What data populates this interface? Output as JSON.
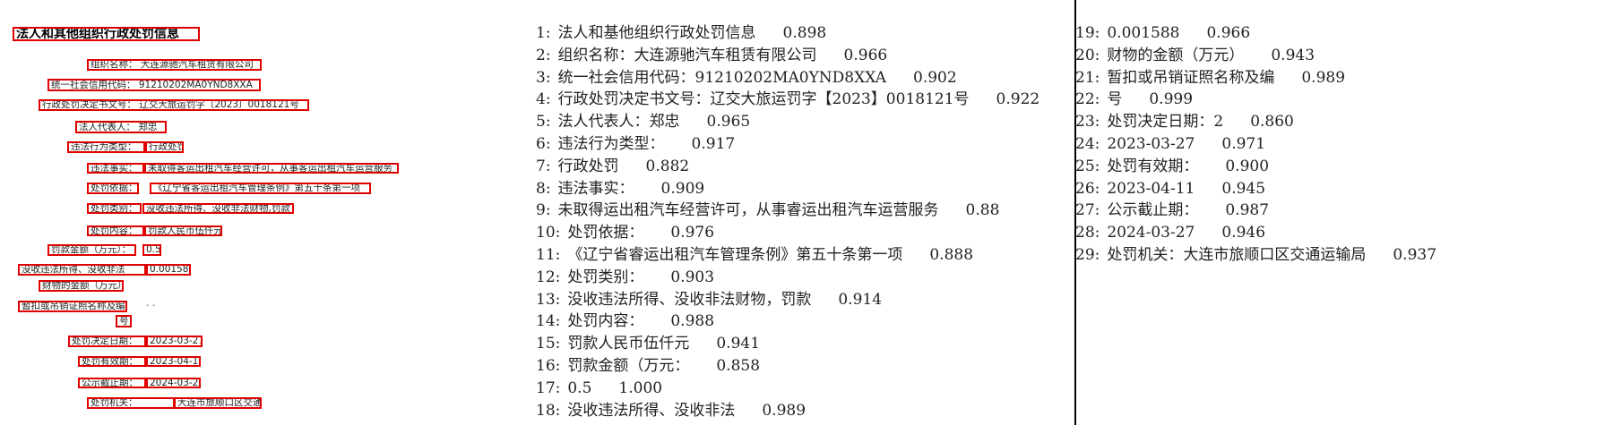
{
  "document": {
    "title": "法人和其他组织行政处罚信息",
    "fields": {
      "org_name": "组织名称： 大连源驰汽车租赁有限公司",
      "credit_code": "统一社会信用代码： 91210202MA0YND8XXA",
      "decision_no": "行政处罚决定书文号： 辽交大旅运罚字〔2023〕0018121号",
      "legal_rep": "法人代表人： 郑忠",
      "violation_type_label": "违法行为类型：",
      "violation_type_value": "行政处罚",
      "facts_label": "违法事实：",
      "facts_value": "未取得客运出租汽车经营许可，从事客运出租汽车运营服务",
      "basis_label": "处罚依据：",
      "basis_value": "《辽宁省客运出租汽车管理条例》第五十条第一项",
      "category_label": "处罚类别：",
      "category_value": "没收违法所得、没收非法财物,罚款",
      "content_label": "处罚内容：",
      "content_value": "罚款人民币伍仟元",
      "fine_label": "罚款金额（万元）：",
      "fine_value": "0.5",
      "confiscate_label": "没收违法所得、没收非法",
      "confiscate_value": "0.001588",
      "confiscate_label2": "财物的金额（万元）",
      "license_label": "暂扣或吊销证照名称及编",
      "license_value": "- -",
      "license_label2": "号",
      "decision_date_label": "处罚决定日期：",
      "decision_date_value": "2023-03-27",
      "valid_label": "处罚有效期：",
      "valid_value": "2023-04-11",
      "publicity_label": "公示截止期：",
      "publicity_value": "2024-03-27",
      "authority_label": "处罚机关：",
      "authority_value": "大连市旅顺口区交通运输局"
    }
  },
  "results": [
    {
      "idx": "1:",
      "text": "法人和基他组织行政处罚信息",
      "score": "0.898"
    },
    {
      "idx": "2:",
      "text": "组织名称：大连源驰汽车租赁有限公司",
      "score": "0.966"
    },
    {
      "idx": "3:",
      "text": "统一社会信用代码：91210202MA0YND8XXA",
      "score": "0.902"
    },
    {
      "idx": "4:",
      "text": "行政处罚决定书文号：辽交大旅运罚字【2023】0018121号",
      "score": "0.922"
    },
    {
      "idx": "5:",
      "text": "法人代表人：郑忠",
      "score": "0.965"
    },
    {
      "idx": "6:",
      "text": "违法行为类型：",
      "score": "0.917"
    },
    {
      "idx": "7:",
      "text": "行政处罚",
      "score": "0.882"
    },
    {
      "idx": "8:",
      "text": "违法事实：",
      "score": "0.909"
    },
    {
      "idx": "9:",
      "text": "未取得运出租汽车经营许可，从事睿运出租汽车运营服务",
      "score": "0.88"
    },
    {
      "idx": "10:",
      "text": "处罚依据：",
      "score": "0.976"
    },
    {
      "idx": "11:",
      "text": "《辽宁省睿运出租汽车管理条例》第五十条第一项",
      "score": "0.888"
    },
    {
      "idx": "12:",
      "text": "处罚类别：",
      "score": "0.903"
    },
    {
      "idx": "13:",
      "text": "没收违法所得、没收非法财物，罚款",
      "score": "0.914"
    },
    {
      "idx": "14:",
      "text": "处罚内容：",
      "score": "0.988"
    },
    {
      "idx": "15:",
      "text": "罚款人民币伍仟元",
      "score": "0.941"
    },
    {
      "idx": "16:",
      "text": "罚款金额（万元：",
      "score": "0.858"
    },
    {
      "idx": "17:",
      "text": "0.5",
      "score": "1.000"
    },
    {
      "idx": "18:",
      "text": "没收违法所得、没收非法",
      "score": "0.989"
    },
    {
      "idx": "19:",
      "text": "0.001588",
      "score": "0.966"
    },
    {
      "idx": "20:",
      "text": "财物的金额（万元）",
      "score": "0.943"
    },
    {
      "idx": "21:",
      "text": "暂扣或吊销证照名称及编",
      "score": "0.989"
    },
    {
      "idx": "22:",
      "text": "号",
      "score": "0.999"
    },
    {
      "idx": "23:",
      "text": "处罚决定日期：2",
      "score": "0.860"
    },
    {
      "idx": "24:",
      "text": "2023-03-27",
      "score": "0.971"
    },
    {
      "idx": "25:",
      "text": "处罚有效期：",
      "score": "0.900"
    },
    {
      "idx": "26:",
      "text": "2023-04-11",
      "score": "0.945"
    },
    {
      "idx": "27:",
      "text": "公示截止期：",
      "score": "0.987"
    },
    {
      "idx": "28:",
      "text": "2024-03-27",
      "score": "0.946"
    },
    {
      "idx": "29:",
      "text": "处罚机关：大连市旅顺口区交通运输局",
      "score": "0.937"
    }
  ],
  "colors": {
    "box": "#e00000",
    "divider": "#000000"
  }
}
